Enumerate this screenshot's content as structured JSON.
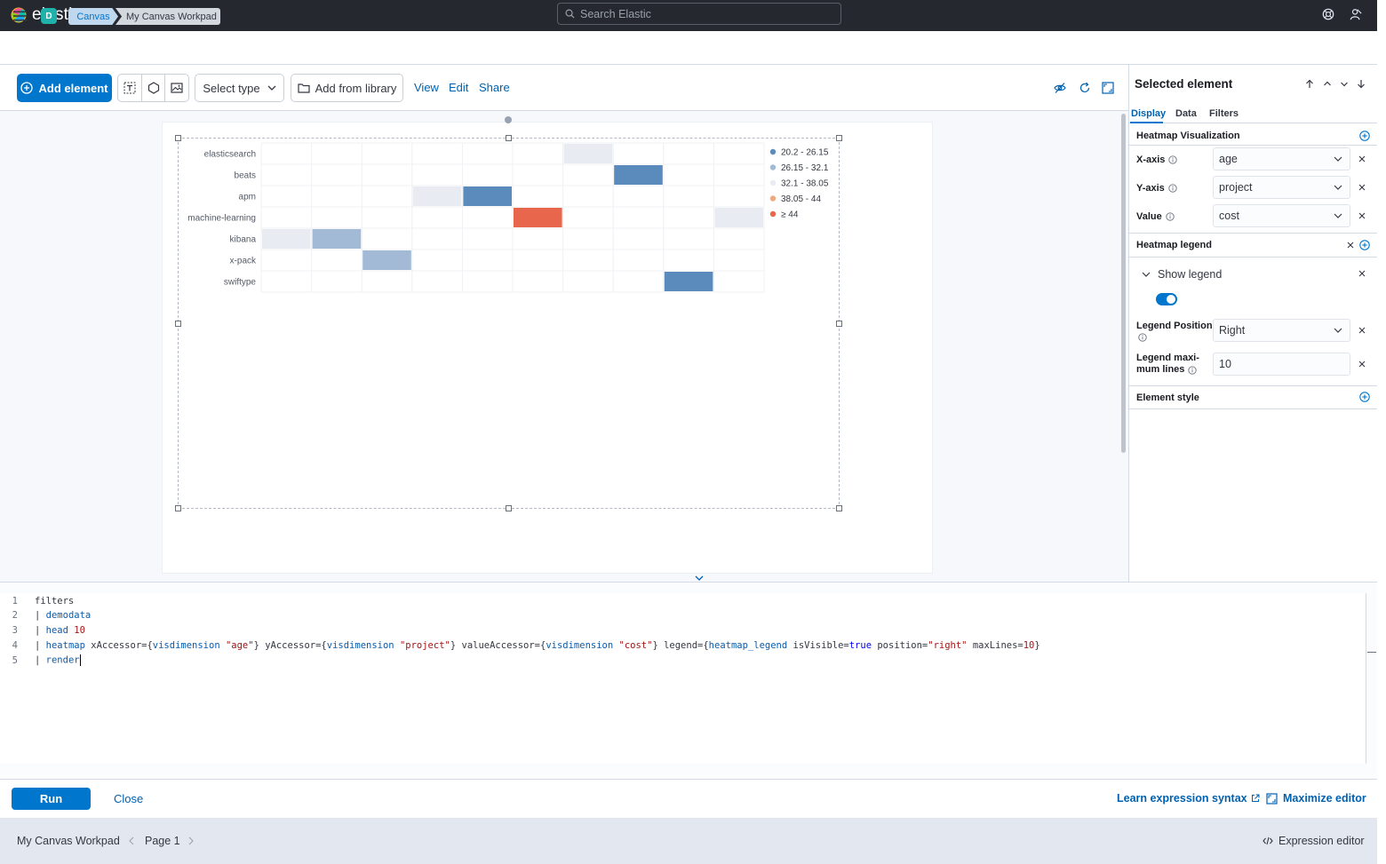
{
  "header": {
    "brand": "elastic",
    "search_placeholder": "Search Elastic"
  },
  "breadcrumbs": {
    "space_initial": "D",
    "items": [
      "Canvas",
      "My Canvas Workpad"
    ]
  },
  "toolbar": {
    "add_element": "Add element",
    "select_type": "Select type",
    "add_from_library": "Add from library",
    "view": "View",
    "edit": "Edit",
    "share": "Share"
  },
  "chart_data": {
    "type": "heatmap",
    "y_categories": [
      "elasticsearch",
      "beats",
      "apm",
      "machine-learning",
      "kibana",
      "x-pack",
      "swiftype"
    ],
    "x_column_count": 10,
    "cells": [
      {
        "y": "elasticsearch",
        "x": 6,
        "bucket": 2
      },
      {
        "y": "beats",
        "x": 7,
        "bucket": 0
      },
      {
        "y": "apm",
        "x": 3,
        "bucket": 2
      },
      {
        "y": "apm",
        "x": 4,
        "bucket": 0
      },
      {
        "y": "machine-learning",
        "x": 5,
        "bucket": 4
      },
      {
        "y": "machine-learning",
        "x": 9,
        "bucket": 2
      },
      {
        "y": "kibana",
        "x": 0,
        "bucket": 2
      },
      {
        "y": "kibana",
        "x": 1,
        "bucket": 1
      },
      {
        "y": "x-pack",
        "x": 2,
        "bucket": 1
      },
      {
        "y": "swiftype",
        "x": 8,
        "bucket": 0
      }
    ],
    "legend": {
      "position": "right",
      "entries": [
        {
          "label": "20.2 - 26.15",
          "color": "#5b8bbd"
        },
        {
          "label": "26.15 - 32.1",
          "color": "#a2bad6"
        },
        {
          "label": "32.1 - 38.05",
          "color": "#e8ecf2"
        },
        {
          "label": "38.05 - 44",
          "color": "#f0a97e"
        },
        {
          "label": "≥ 44",
          "color": "#e7664c"
        }
      ]
    },
    "cell_colors": [
      "#5b8bbd",
      "#a2bad6",
      "#e8ecf2",
      "#f0a97e",
      "#e7664c"
    ]
  },
  "editor": {
    "lines": [
      [
        {
          "t": "filters",
          "c": ""
        }
      ],
      [
        {
          "t": "| ",
          "c": ""
        },
        {
          "t": "demodata",
          "c": "k"
        }
      ],
      [
        {
          "t": "| ",
          "c": ""
        },
        {
          "t": "head",
          "c": "k"
        },
        {
          "t": " ",
          "c": ""
        },
        {
          "t": "10",
          "c": "s"
        }
      ],
      [
        {
          "t": "| ",
          "c": ""
        },
        {
          "t": "heatmap",
          "c": "k"
        },
        {
          "t": " xAccessor={",
          "c": ""
        },
        {
          "t": "visdimension",
          "c": "k"
        },
        {
          "t": " ",
          "c": ""
        },
        {
          "t": "\"age\"",
          "c": "s"
        },
        {
          "t": "} yAccessor={",
          "c": ""
        },
        {
          "t": "visdimension",
          "c": "k"
        },
        {
          "t": " ",
          "c": ""
        },
        {
          "t": "\"project\"",
          "c": "s"
        },
        {
          "t": "} valueAccessor={",
          "c": ""
        },
        {
          "t": "visdimension",
          "c": "k"
        },
        {
          "t": " ",
          "c": ""
        },
        {
          "t": "\"cost\"",
          "c": "s"
        },
        {
          "t": "} legend={",
          "c": ""
        },
        {
          "t": "heatmap_legend",
          "c": "k"
        },
        {
          "t": " isVisible=",
          "c": ""
        },
        {
          "t": "true",
          "c": "b"
        },
        {
          "t": " position=",
          "c": ""
        },
        {
          "t": "\"right\"",
          "c": "s"
        },
        {
          "t": " maxLines=",
          "c": ""
        },
        {
          "t": "10",
          "c": "s"
        },
        {
          "t": "}",
          "c": ""
        }
      ],
      [
        {
          "t": "| ",
          "c": ""
        },
        {
          "t": "render",
          "c": "k"
        }
      ]
    ],
    "run": "Run",
    "close": "Close",
    "learn_syntax": "Learn expression syntax",
    "maximize": "Maximize editor"
  },
  "bottombar": {
    "workpad_name": "My Canvas Workpad",
    "page": "Page 1",
    "expression_editor": "Expression editor"
  },
  "sidebar": {
    "title": "Selected element",
    "tabs": [
      "Display",
      "Data",
      "Filters"
    ],
    "heatmap_vis_title": "Heatmap Visualization",
    "x_axis_label": "X-axis",
    "x_axis_value": "age",
    "y_axis_label": "Y-axis",
    "y_axis_value": "project",
    "value_label": "Value",
    "value_value": "cost",
    "legend_title": "Heatmap legend",
    "show_legend": "Show legend",
    "legend_position_label": "Legend Position",
    "legend_position_value": "Right",
    "legend_max_lines_label_1": "Legend maxi-",
    "legend_max_lines_label_2": "mum lines",
    "legend_max_lines_value": "10",
    "element_style_title": "Element style"
  }
}
